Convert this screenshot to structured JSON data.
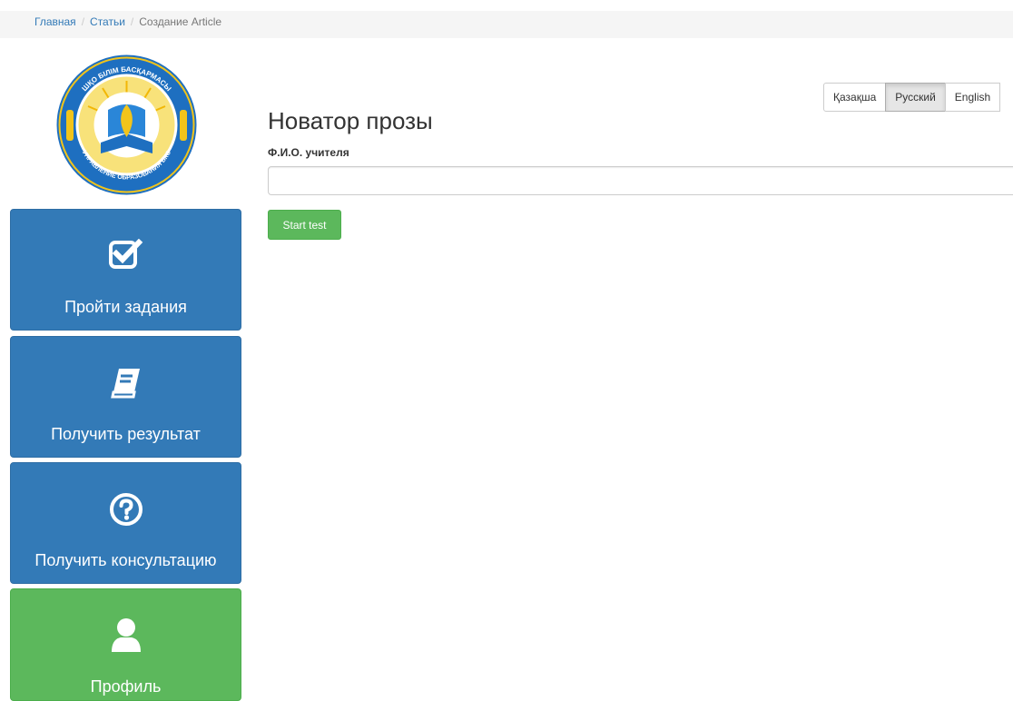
{
  "breadcrumb": {
    "home": "Главная",
    "articles": "Статьи",
    "current": "Создание Article",
    "separator": "/"
  },
  "logo": {
    "top_text": "ШҚО БІЛІМ БАСҚАРМАСЫ",
    "bottom_text": "УПРАВЛЕНИЕ ОБРАЗОВАНИЯ ВКО"
  },
  "sidebar": {
    "items": [
      {
        "label": "Пройти задания",
        "icon": "checkbox-icon",
        "color": "#337ab7"
      },
      {
        "label": "Получить результат",
        "icon": "book-icon",
        "color": "#337ab7"
      },
      {
        "label": "Получить консультацию",
        "icon": "question-circle-icon",
        "color": "#337ab7"
      },
      {
        "label": "Профиль",
        "icon": "user-icon",
        "color": "#5cb85c"
      }
    ]
  },
  "languages": {
    "items": [
      "Қазақша",
      "Русский",
      "English"
    ],
    "active": "Русский"
  },
  "main": {
    "title": "Новатор прозы",
    "field_label": "Ф.И.О. учителя",
    "field_value": "",
    "start_label": "Start test"
  },
  "colors": {
    "primary": "#337ab7",
    "success": "#5cb85c",
    "link": "#337ab7"
  }
}
